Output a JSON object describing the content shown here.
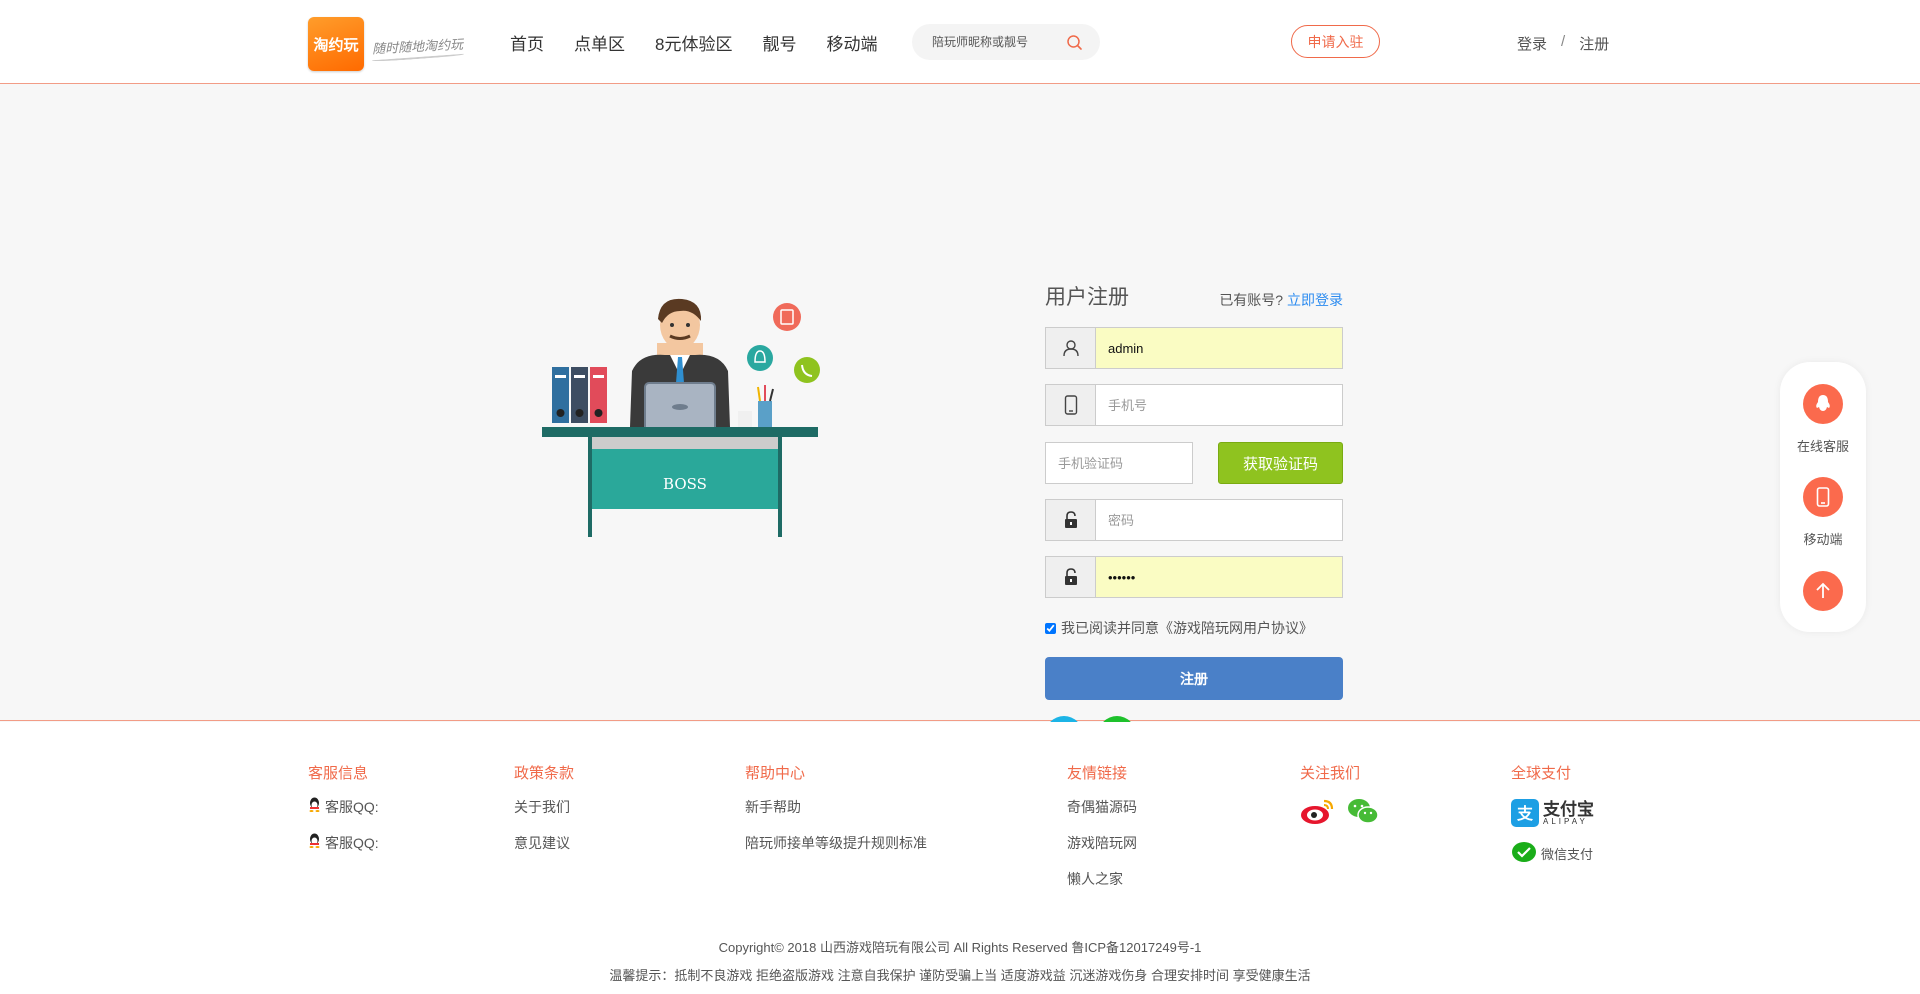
{
  "header": {
    "logo_text": "淘约玩",
    "slogan": "随时随地淘约玩",
    "nav": [
      "首页",
      "点单区",
      "8元体验区",
      "靓号",
      "移动端"
    ],
    "search_placeholder": "陪玩师昵称或靓号",
    "apply_label": "申请入驻",
    "login_label": "登录",
    "separator": "/",
    "register_label": "注册"
  },
  "illustration": {
    "desk_label": "BOSS"
  },
  "form": {
    "title": "用户注册",
    "has_account_text": "已有账号?",
    "login_link": "立即登录",
    "username_value": "admin",
    "phone_placeholder": "手机号",
    "code_placeholder": "手机验证码",
    "get_code_label": "获取验证码",
    "password_placeholder": "密码",
    "confirm_password_value": "••••••",
    "agree_text": "我已阅读并同意《游戏陪玩网用户协议》",
    "agree_checked": true,
    "submit_label": "注册"
  },
  "float_bar": {
    "items": [
      {
        "label": "在线客服",
        "icon": "qq-icon"
      },
      {
        "label": "移动端",
        "icon": "mobile-icon"
      },
      {
        "label": "",
        "icon": "arrow-up-icon"
      }
    ]
  },
  "footer": {
    "columns": [
      {
        "title": "客服信息",
        "links": [
          "客服QQ:",
          "客服QQ:"
        ]
      },
      {
        "title": "政策条款",
        "links": [
          "关于我们",
          "意见建议"
        ]
      },
      {
        "title": "帮助中心",
        "links": [
          "新手帮助",
          "陪玩师接单等级提升规则标准"
        ]
      },
      {
        "title": "友情链接",
        "links": [
          "奇偶猫源码",
          "游戏陪玩网",
          "懒人之家"
        ]
      },
      {
        "title": "关注我们",
        "links": []
      },
      {
        "title": "全球支付",
        "links": [
          "支付宝",
          "ALIPAY",
          "微信支付"
        ]
      }
    ],
    "copyright": "Copyright© 2018 山西游戏陪玩有限公司 All Rights Reserved 鲁ICP备12017249号-1",
    "tips": "温馨提示：抵制不良游戏 拒绝盗版游戏 注意自我保护 谨防受骗上当 适度游戏益 沉迷游戏伤身 合理安排时间 享受健康生活"
  },
  "colors": {
    "accent": "#f06a4a",
    "link_blue": "#2d8cf0",
    "green_button": "#8fc31f",
    "submit_blue": "#4a80c8",
    "autofill_yellow": "#fafcc3"
  }
}
